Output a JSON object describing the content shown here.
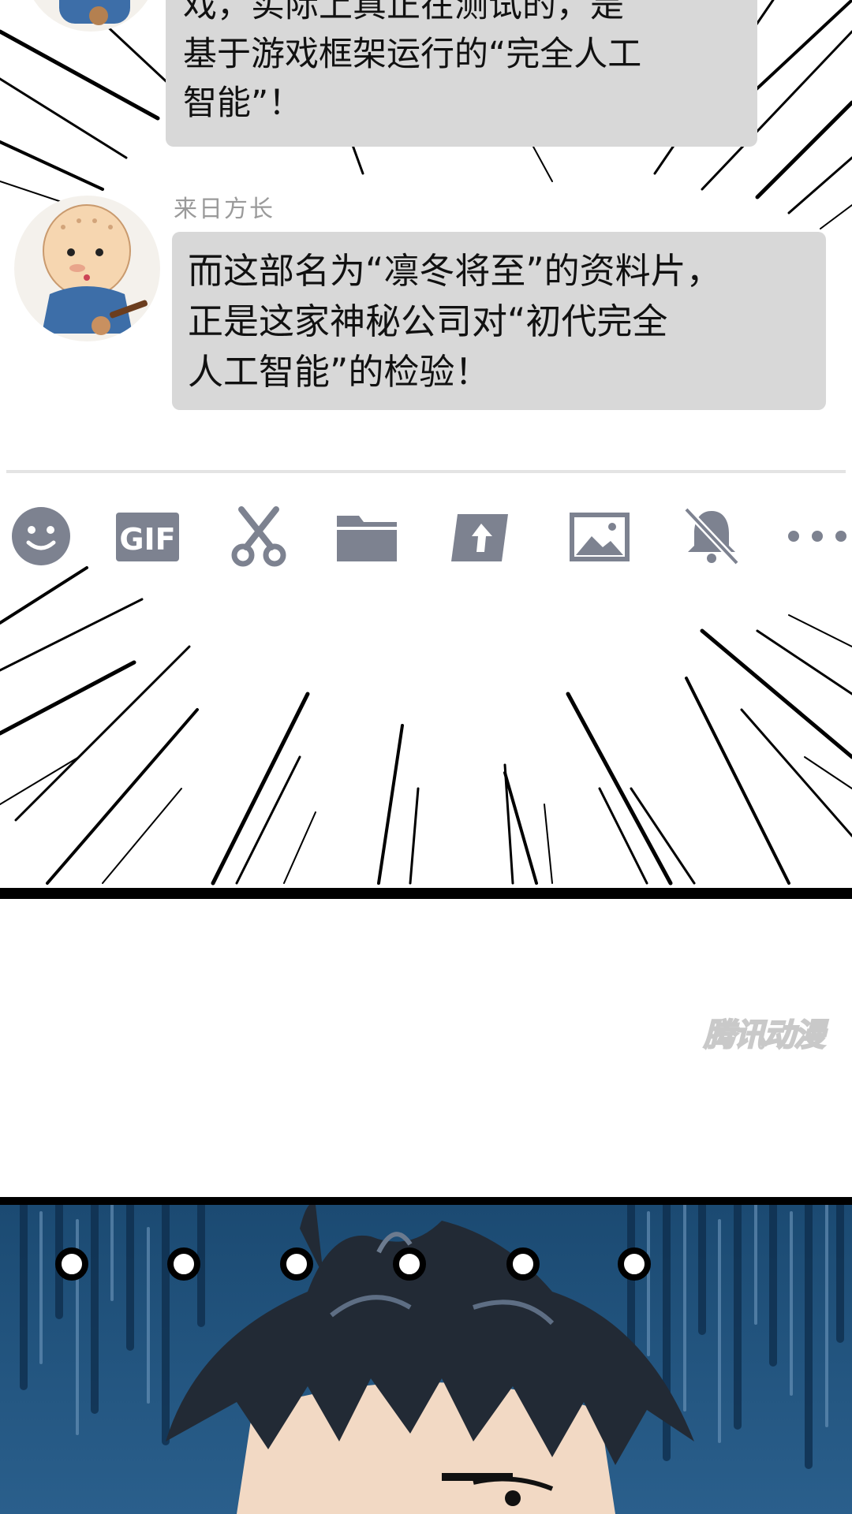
{
  "chat": {
    "message_1": {
      "lines": [
        "戏，实际上真正在测试的，是",
        "基于游戏框架运行的“完全人工",
        "智能”！"
      ]
    },
    "message_2": {
      "sender": "来日方长",
      "lines": [
        "而这部名为“凛冬将至”的资料片，",
        "正是这家神秘公司对“初代完全",
        "人工智能”的检验！"
      ]
    }
  },
  "toolbar": {
    "icons": [
      "emoji-icon",
      "gif-icon",
      "scissors-icon",
      "folder-icon",
      "share-icon",
      "image-icon",
      "bell-mute-icon",
      "more-icon"
    ],
    "gif_label": "GIF"
  },
  "watermark": "腾讯动漫",
  "colors": {
    "bubble": "#d8d8d8",
    "icon": "#7d8290",
    "panel_bg": "#1c4a73"
  }
}
